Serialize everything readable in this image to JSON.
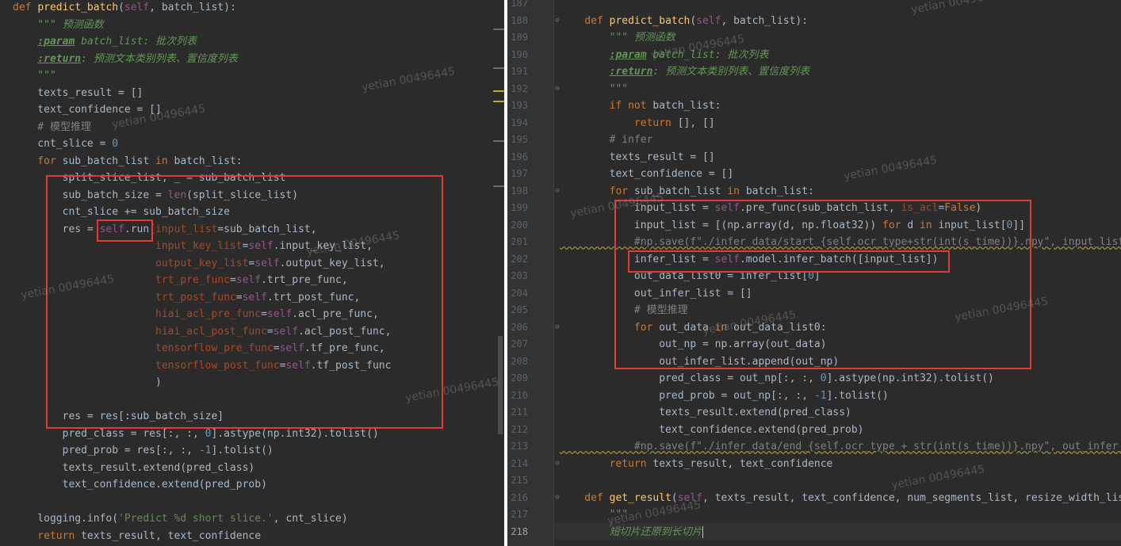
{
  "watermark": "yetian 00496445",
  "left": {
    "lines": [
      [
        [
          "kw",
          "def "
        ],
        [
          "fn",
          "predict_batch"
        ],
        [
          "",
          "("
        ],
        [
          "sf",
          "self"
        ],
        [
          "",
          ", batch_list):"
        ]
      ],
      [
        [
          "doc",
          "    \"\"\" 预测函数"
        ]
      ],
      [
        [
          "doc",
          "    "
        ],
        [
          "dtag",
          ":param"
        ],
        [
          "doc",
          " batch_list: 批次列表"
        ]
      ],
      [
        [
          "doc",
          "    "
        ],
        [
          "dtag",
          ":return"
        ],
        [
          "doc",
          ": 预测文本类别列表、置信度列表"
        ]
      ],
      [
        [
          "doc",
          "    \"\"\""
        ]
      ],
      [
        [
          "",
          "    texts_result = []"
        ]
      ],
      [
        [
          "",
          "    text_confidence = []"
        ]
      ],
      [
        [
          "cmt",
          "    # 模型推理"
        ]
      ],
      [
        [
          "",
          "    cnt_slice = "
        ],
        [
          "num",
          "0"
        ]
      ],
      [
        [
          "kw",
          "    for "
        ],
        [
          "",
          "sub_batch_list "
        ],
        [
          "kw",
          "in "
        ],
        [
          "",
          "batch_list:"
        ]
      ],
      [
        [
          "",
          "        split_slice_list, _ = sub_batch_list"
        ]
      ],
      [
        [
          "",
          "        sub_batch_size = "
        ],
        [
          "sf",
          "len"
        ],
        [
          "",
          "(split_slice_list)"
        ]
      ],
      [
        [
          "",
          "        cnt_slice += sub_batch_size"
        ]
      ],
      [
        [
          "",
          "        res = "
        ],
        [
          "sf",
          "self"
        ],
        [
          "",
          ".run("
        ],
        [
          "kwarg",
          "input_list"
        ],
        [
          "",
          "=sub_batch_list,"
        ]
      ],
      [
        [
          "",
          "                       "
        ],
        [
          "kwarg",
          "input_key_list"
        ],
        [
          "",
          "="
        ],
        [
          "sf",
          "self"
        ],
        [
          "",
          ".input_key_list,"
        ]
      ],
      [
        [
          "",
          "                       "
        ],
        [
          "kwarg",
          "output_key_list"
        ],
        [
          "",
          "="
        ],
        [
          "sf",
          "self"
        ],
        [
          "",
          ".output_key_list,"
        ]
      ],
      [
        [
          "",
          "                       "
        ],
        [
          "kwarg",
          "trt_pre_func"
        ],
        [
          "",
          "="
        ],
        [
          "sf",
          "self"
        ],
        [
          "",
          ".trt_pre_func,"
        ]
      ],
      [
        [
          "",
          "                       "
        ],
        [
          "kwarg",
          "trt_post_func"
        ],
        [
          "",
          "="
        ],
        [
          "sf",
          "self"
        ],
        [
          "",
          ".trt_post_func,"
        ]
      ],
      [
        [
          "",
          "                       "
        ],
        [
          "kwarg",
          "hiai_acl_pre_func"
        ],
        [
          "",
          "="
        ],
        [
          "sf",
          "self"
        ],
        [
          "",
          ".acl_pre_func,"
        ]
      ],
      [
        [
          "",
          "                       "
        ],
        [
          "kwarg",
          "hiai_acl_post_func"
        ],
        [
          "",
          "="
        ],
        [
          "sf",
          "self"
        ],
        [
          "",
          ".acl_post_func,"
        ]
      ],
      [
        [
          "",
          "                       "
        ],
        [
          "kwarg",
          "tensorflow_pre_func"
        ],
        [
          "",
          "="
        ],
        [
          "sf",
          "self"
        ],
        [
          "",
          ".tf_pre_func,"
        ]
      ],
      [
        [
          "",
          "                       "
        ],
        [
          "kwarg",
          "tensorflow_post_func"
        ],
        [
          "",
          "="
        ],
        [
          "sf",
          "self"
        ],
        [
          "",
          ".tf_post_func"
        ]
      ],
      [
        [
          "",
          "                       )"
        ]
      ],
      [
        [
          "",
          ""
        ]
      ],
      [
        [
          "",
          "        res = res[:sub_batch_size]"
        ]
      ],
      [
        [
          "",
          "        pred_class = res[:, :, "
        ],
        [
          "num",
          "0"
        ],
        [
          "",
          "].astype(np.int32).tolist()"
        ]
      ],
      [
        [
          "",
          "        pred_prob = res[:, :, "
        ],
        [
          "num",
          "-1"
        ],
        [
          "",
          "].tolist()"
        ]
      ],
      [
        [
          "",
          "        texts_result.extend(pred_class)"
        ]
      ],
      [
        [
          "",
          "        text_confidence.extend(pred_prob)"
        ]
      ],
      [
        [
          "",
          ""
        ]
      ],
      [
        [
          "",
          "    logging.info("
        ],
        [
          "str",
          "'Predict %d short slice.'"
        ],
        [
          "",
          ", cnt_slice)"
        ]
      ],
      [
        [
          "kw",
          "    return "
        ],
        [
          "",
          "texts_result, text_confidence"
        ]
      ]
    ]
  },
  "right": {
    "line_numbers": [
      "187",
      "188",
      "189",
      "190",
      "191",
      "192",
      "193",
      "194",
      "195",
      "196",
      "197",
      "198",
      "199",
      "200",
      "201",
      "202",
      "203",
      "204",
      "205",
      "206",
      "207",
      "208",
      "209",
      "210",
      "211",
      "212",
      "213",
      "214",
      "215",
      "216",
      "217",
      "218"
    ],
    "current_line": "218",
    "lines": [
      [
        [
          "",
          ""
        ]
      ],
      [
        [
          "kw",
          "    def "
        ],
        [
          "fn",
          "predict_batch"
        ],
        [
          "",
          "("
        ],
        [
          "sf",
          "self"
        ],
        [
          "",
          ", batch_list):"
        ]
      ],
      [
        [
          "doc",
          "        \"\"\" 预测函数"
        ]
      ],
      [
        [
          "doc",
          "        "
        ],
        [
          "dtag",
          ":param"
        ],
        [
          "doc",
          " batch_list: 批次列表"
        ]
      ],
      [
        [
          "doc",
          "        "
        ],
        [
          "dtag",
          ":return"
        ],
        [
          "doc",
          ": 预测文本类别列表、置信度列表"
        ]
      ],
      [
        [
          "doc",
          "        \"\"\""
        ]
      ],
      [
        [
          "kw",
          "        if not "
        ],
        [
          "",
          "batch_list:"
        ]
      ],
      [
        [
          "kw",
          "            return "
        ],
        [
          "",
          "[], []"
        ]
      ],
      [
        [
          "cmt",
          "        # infer"
        ]
      ],
      [
        [
          "",
          "        texts_result = []"
        ]
      ],
      [
        [
          "",
          "        text_confidence = []"
        ]
      ],
      [
        [
          "kw",
          "        for "
        ],
        [
          "",
          "sub_batch_list "
        ],
        [
          "kw",
          "in "
        ],
        [
          "",
          "batch_list:"
        ]
      ],
      [
        [
          "",
          "            input_list = "
        ],
        [
          "sf",
          "self"
        ],
        [
          "",
          ".pre_func(sub_batch_list, "
        ],
        [
          "kwarg",
          "is_acl"
        ],
        [
          "",
          "="
        ],
        [
          "kw",
          "False"
        ],
        [
          "",
          ")"
        ]
      ],
      [
        [
          "",
          "            input_list = [(np.array(d, np.float32)) "
        ],
        [
          "kw",
          "for "
        ],
        [
          "",
          "d "
        ],
        [
          "kw",
          "in "
        ],
        [
          "",
          "input_list["
        ],
        [
          "num",
          "0"
        ],
        [
          "",
          "]]"
        ]
      ],
      [
        [
          "cmt-ul",
          "            #np.save(f\"./infer_data/start_{self.ocr_type+str(int(s_time))}.npy\", input_list)"
        ]
      ],
      [
        [
          "",
          "            infer_list = "
        ],
        [
          "sf",
          "self"
        ],
        [
          "",
          ".model.infer_batch([input_list])"
        ]
      ],
      [
        [
          "",
          "            out_data_list0 = infer_list["
        ],
        [
          "num",
          "0"
        ],
        [
          "",
          "]"
        ]
      ],
      [
        [
          "",
          "            out_infer_list = []"
        ]
      ],
      [
        [
          "cmt",
          "            # 模型推理"
        ]
      ],
      [
        [
          "kw",
          "            for "
        ],
        [
          "",
          "out_data "
        ],
        [
          "kw",
          "in "
        ],
        [
          "",
          "out_data_list0:"
        ]
      ],
      [
        [
          "",
          "                out_np = np.array(out_data)"
        ]
      ],
      [
        [
          "",
          "                out_infer_list.append(out_np)"
        ]
      ],
      [
        [
          "",
          "                pred_class = out_np[:, :, "
        ],
        [
          "num",
          "0"
        ],
        [
          "",
          "].astype(np.int32).tolist()"
        ]
      ],
      [
        [
          "",
          "                pred_prob = out_np[:, :, "
        ],
        [
          "num",
          "-1"
        ],
        [
          "",
          "].tolist()"
        ]
      ],
      [
        [
          "",
          "                texts_result.extend(pred_class)"
        ]
      ],
      [
        [
          "",
          "                text_confidence.extend(pred_prob)"
        ]
      ],
      [
        [
          "cmt-ul",
          "            #np.save(f\"./infer_data/end_{self.ocr_type + str(int(s_time))}.npy\", out_infer_list)"
        ]
      ],
      [
        [
          "kw",
          "        return "
        ],
        [
          "",
          "texts_result, text_confidence"
        ]
      ],
      [
        [
          "",
          ""
        ]
      ],
      [
        [
          "kw",
          "    def "
        ],
        [
          "fn",
          "get_result"
        ],
        [
          "",
          "("
        ],
        [
          "sf",
          "self"
        ],
        [
          "",
          ", texts_result, text_confidence, num_segments_list, resize_width_list"
        ]
      ],
      [
        [
          "doc",
          "        \"\"\""
        ]
      ],
      [
        [
          "doc",
          "        短切片还原到长切片"
        ],
        [
          "caret",
          ""
        ]
      ]
    ]
  }
}
